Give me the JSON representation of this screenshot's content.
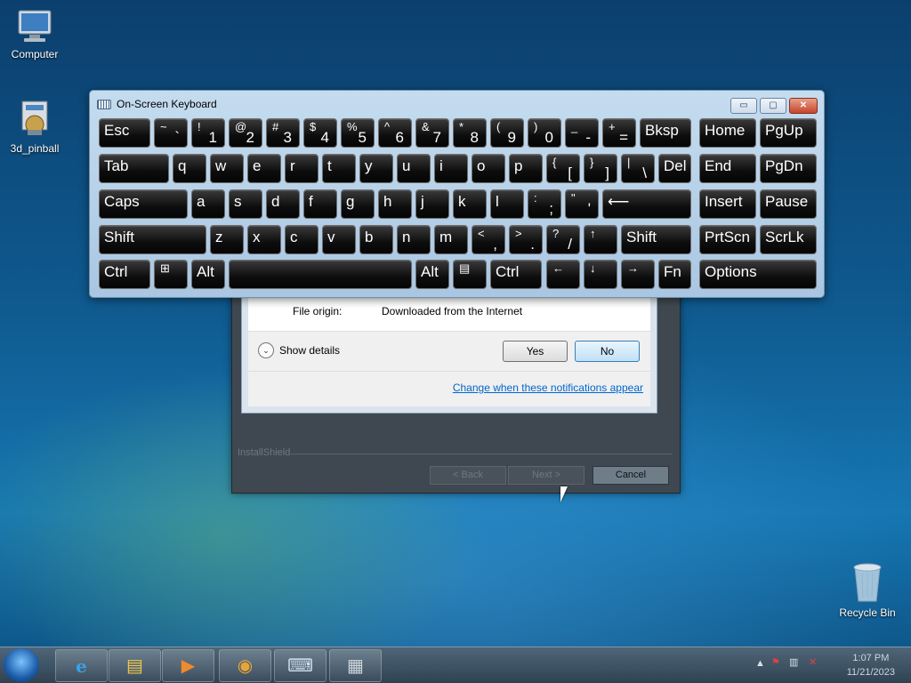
{
  "desktop": {
    "icons": [
      {
        "label": "Computer",
        "icon": "computer-icon"
      },
      {
        "label": "3d_pinball",
        "icon": "installer-icon"
      },
      {
        "label": "Recycle Bin",
        "icon": "recycle-bin-icon"
      }
    ]
  },
  "installer": {
    "brand": "InstallShield",
    "back": "< Back",
    "next": "Next >",
    "cancel": "Cancel"
  },
  "uac": {
    "file_origin_label": "File origin:",
    "file_origin_value": "Downloaded from the Internet",
    "show_details": "Show details",
    "yes": "Yes",
    "no": "No",
    "link": "Change when these notifications appear"
  },
  "osk": {
    "title": "On-Screen Keyboard",
    "min": "▭",
    "restore": "▢",
    "close": "✕",
    "keys": {
      "esc": "Esc",
      "tilde_top": "~",
      "tilde_bot": "`",
      "k1_top": "!",
      "k1_bot": "1",
      "k2_top": "@",
      "k2_bot": "2",
      "k3_top": "#",
      "k3_bot": "3",
      "k4_top": "$",
      "k4_bot": "4",
      "k5_top": "%",
      "k5_bot": "5",
      "k6_top": "^",
      "k6_bot": "6",
      "k7_top": "&",
      "k7_bot": "7",
      "k8_top": "*",
      "k8_bot": "8",
      "k9_top": "(",
      "k9_bot": "9",
      "k0_top": ")",
      "k0_bot": "0",
      "minus_top": "_",
      "minus_bot": "-",
      "plus_top": "+",
      "plus_bot": "=",
      "bksp": "Bksp",
      "home": "Home",
      "pgup": "PgUp",
      "tab": "Tab",
      "q": "q",
      "w": "w",
      "e": "e",
      "r": "r",
      "t": "t",
      "y": "y",
      "u": "u",
      "i": "i",
      "o": "o",
      "p": "p",
      "lbr_top": "{",
      "lbr_bot": "[",
      "rbr_top": "}",
      "rbr_bot": "]",
      "bs_top": "|",
      "bs_bot": "\\",
      "del": "Del",
      "end": "End",
      "pgdn": "PgDn",
      "caps": "Caps",
      "a": "a",
      "s": "s",
      "d": "d",
      "f": "f",
      "g": "g",
      "h": "h",
      "j": "j",
      "k": "k",
      "l": "l",
      "semi_top": ":",
      "semi_bot": ";",
      "quote_top": "\"",
      "quote_bot": "'",
      "enter": "⟵",
      "insert": "Insert",
      "pause": "Pause",
      "shift": "Shift",
      "z": "z",
      "x": "x",
      "c": "c",
      "v": "v",
      "b": "b",
      "n": "n",
      "m": "m",
      "comma_top": "<",
      "comma_bot": ",",
      "period_top": ">",
      "period_bot": ".",
      "slash_top": "?",
      "slash_bot": "/",
      "up": "↑",
      "prtscn": "PrtScn",
      "scrlk": "ScrLk",
      "ctrl": "Ctrl",
      "win": "⊞",
      "alt": "Alt",
      "menu": "▤",
      "left": "←",
      "down": "↓",
      "right": "→",
      "fn": "Fn",
      "options": "Options"
    }
  },
  "taskbar": {
    "start_icon": "windows-start-icon",
    "apps": [
      {
        "name": "internet-explorer-icon",
        "glyph": "e"
      },
      {
        "name": "file-explorer-icon",
        "glyph": "▤"
      },
      {
        "name": "media-player-icon",
        "glyph": "▶"
      },
      {
        "name": "chrome-icon",
        "glyph": "◉"
      },
      {
        "name": "on-screen-keyboard-icon",
        "glyph": "⌨"
      },
      {
        "name": "installer-icon",
        "glyph": "▦"
      }
    ],
    "time": "1:07 PM",
    "date": "11/21/2023"
  }
}
